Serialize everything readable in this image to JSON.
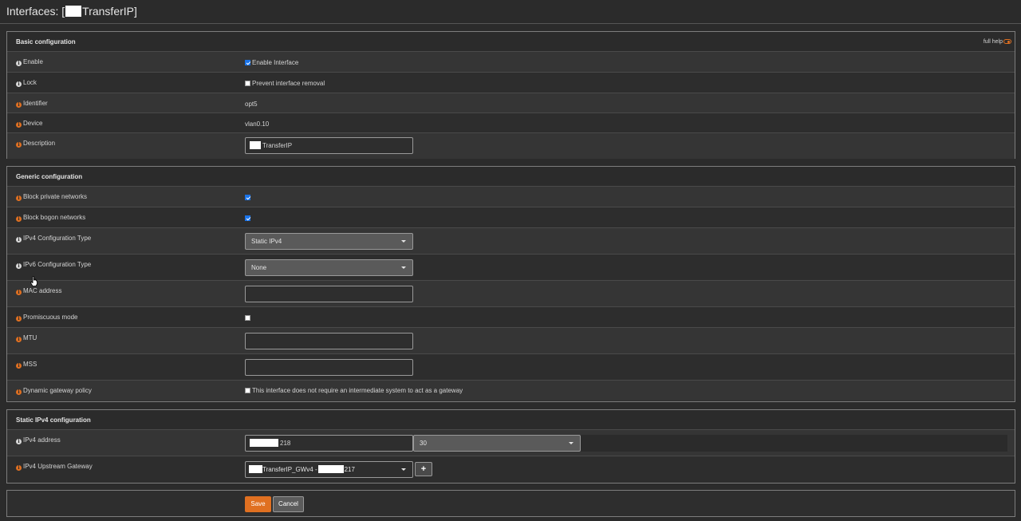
{
  "header": {
    "title_prefix": "Interfaces: [",
    "title_suffix": "TransferIP]"
  },
  "basic": {
    "title": "Basic configuration",
    "full_help": "full help",
    "enable_label": "Enable",
    "enable_text": "Enable Interface",
    "enable_checked": true,
    "lock_label": "Lock",
    "lock_text": "Prevent interface removal",
    "lock_checked": false,
    "identifier_label": "Identifier",
    "identifier_value": "opt5",
    "device_label": "Device",
    "device_value": "vlan0.10",
    "description_label": "Description",
    "description_value": "TransferIP"
  },
  "generic": {
    "title": "Generic configuration",
    "block_private_label": "Block private networks",
    "block_private_checked": true,
    "block_bogon_label": "Block bogon networks",
    "block_bogon_checked": true,
    "ipv4_type_label": "IPv4 Configuration Type",
    "ipv4_type_value": "Static IPv4",
    "ipv6_type_label": "IPv6 Configuration Type",
    "ipv6_type_value": "None",
    "mac_label": "MAC address",
    "mac_value": "",
    "promisc_label": "Promiscuous mode",
    "promisc_checked": false,
    "mtu_label": "MTU",
    "mtu_value": "",
    "mss_label": "MSS",
    "mss_value": "",
    "dyn_gw_label": "Dynamic gateway policy",
    "dyn_gw_text": "This interface does not require an intermediate system to act as a gateway",
    "dyn_gw_checked": false
  },
  "static_ipv4": {
    "title": "Static IPv4 configuration",
    "address_label": "IPv4 address",
    "address_value": "218",
    "subnet_value": "30",
    "gateway_label": "IPv4 Upstream Gateway",
    "gateway_name": "TransferIP_GWv4 -",
    "gateway_ip": "217",
    "add_button": "+"
  },
  "actions": {
    "save": "Save",
    "cancel": "Cancel"
  },
  "colors": {
    "accent": "#e07021",
    "checkbox": "#1a73e8"
  }
}
